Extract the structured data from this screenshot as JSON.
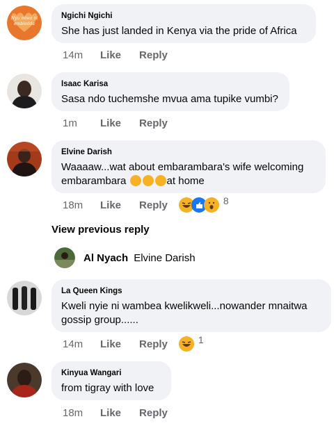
{
  "comments": [
    {
      "author": "Ngichi Ngichi",
      "text": "She has just landed in Kenya via the pride of Africa",
      "time": "14m",
      "like": "Like",
      "reply": "Reply"
    },
    {
      "author": "Isaac Karisa",
      "text": "Sasa ndo tuchemshe mvua ama tupike vumbi?",
      "time": "1m",
      "like": "Like",
      "reply": "Reply"
    },
    {
      "author": "Elvine Darish",
      "text_line1": "Waaaaw...wat about embarambara's wife welcoming",
      "text_line2_a": "embarambara ",
      "text_line2_b": "at home",
      "time": "18m",
      "like": "Like",
      "reply": "Reply",
      "reaction_count": "8",
      "reactions": [
        "laugh-emoji-icon",
        "like-emoji-icon",
        "wow-emoji-icon"
      ]
    },
    {
      "author": "La Queen Kings",
      "text_line1": "Kweli nyie ni wambea kwelikweli...nowander mnaitwa",
      "text_line2": "gossip group......",
      "time": "14m",
      "like": "Like",
      "reply": "Reply",
      "reaction_count": "1",
      "reactions": [
        "laugh-emoji-icon"
      ]
    },
    {
      "author": "Kinyua Wangari",
      "text": "from tigray with love",
      "time": "18m",
      "like": "Like",
      "reply": "Reply"
    }
  ],
  "view_previous": "View previous reply",
  "reply_preview": {
    "author": "Al Nyach",
    "tagged": "Elvine Darish"
  },
  "avatar_texts": {
    "ngichi": "Nyu miwa ni embledda"
  },
  "colors": {
    "bubble": "#f0f2f5",
    "meta": "#65676b",
    "text": "#050505",
    "emoji": "#f7b125",
    "like_blue": "#1877f2"
  }
}
